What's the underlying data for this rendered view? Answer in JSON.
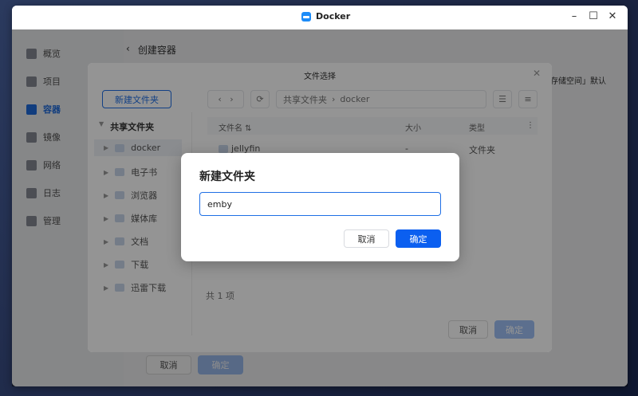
{
  "window": {
    "app_name": "Docker",
    "controls": [
      "minimize",
      "maximize",
      "close"
    ]
  },
  "sidebar": {
    "items": [
      {
        "label": "概览",
        "icon": "overview-icon",
        "active": false
      },
      {
        "label": "项目",
        "icon": "project-icon",
        "active": false
      },
      {
        "label": "容器",
        "icon": "container-icon",
        "active": true
      },
      {
        "label": "镜像",
        "icon": "image-icon",
        "active": false
      },
      {
        "label": "网络",
        "icon": "network-icon",
        "active": false
      },
      {
        "label": "日志",
        "icon": "log-icon",
        "active": false
      },
      {
        "label": "管理",
        "icon": "manage-icon",
        "active": false
      }
    ]
  },
  "page": {
    "back_symbol": "‹",
    "title": "创建容器",
    "bg_text": "存储空间」默认",
    "cancel_label": "取消",
    "ok_label": "确定"
  },
  "picker": {
    "title": "文件选择",
    "new_folder_label": "新建文件夹",
    "tree_root": "共享文件夹",
    "tree_items": [
      "docker",
      "电子书",
      "浏览器",
      "媒体库",
      "文档",
      "下载",
      "迅雷下载"
    ],
    "path_root": "共享文件夹",
    "path_sep": "›",
    "path_leaf": "docker",
    "columns": {
      "name": "文件名",
      "size": "大小",
      "type": "类型"
    },
    "rows": [
      {
        "name": "jellyfin",
        "size": "-",
        "type": "文件夹"
      }
    ],
    "count": "共 1 项",
    "cancel_label": "取消",
    "ok_label": "确定"
  },
  "new_folder_dialog": {
    "title": "新建文件夹",
    "input_value": "emby",
    "cancel_label": "取消",
    "ok_label": "确定"
  },
  "colors": {
    "accent": "#0b5ff0",
    "active_nav": "#1f6fe5"
  }
}
